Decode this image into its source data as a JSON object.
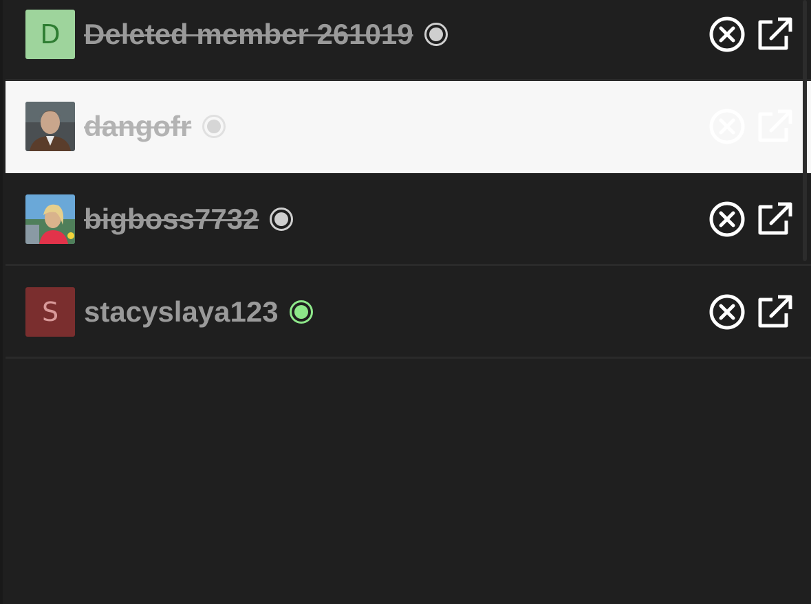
{
  "members": [
    {
      "name": "Deleted member 261019",
      "avatar_type": "letter",
      "avatar_letter": "D",
      "avatar_color": "#9ed49c",
      "struck_through": true,
      "status": "offline",
      "selected": false
    },
    {
      "name": "dangofr",
      "avatar_type": "photo",
      "struck_through": true,
      "status": "offline",
      "selected": true
    },
    {
      "name": "bigboss7732",
      "avatar_type": "photo",
      "struck_through": true,
      "status": "offline",
      "selected": false
    },
    {
      "name": "stacyslaya123",
      "avatar_type": "letter",
      "avatar_letter": "S",
      "avatar_color": "#7a2e2e",
      "struck_through": false,
      "status": "online",
      "selected": false
    }
  ],
  "icons": {
    "remove": "close-circle-icon",
    "open": "external-link-icon"
  },
  "colors": {
    "background": "#1f1f1f",
    "selected_row": "#f7f7f7",
    "online_status": "#8ee88a",
    "offline_status": "#cfcfcf"
  }
}
